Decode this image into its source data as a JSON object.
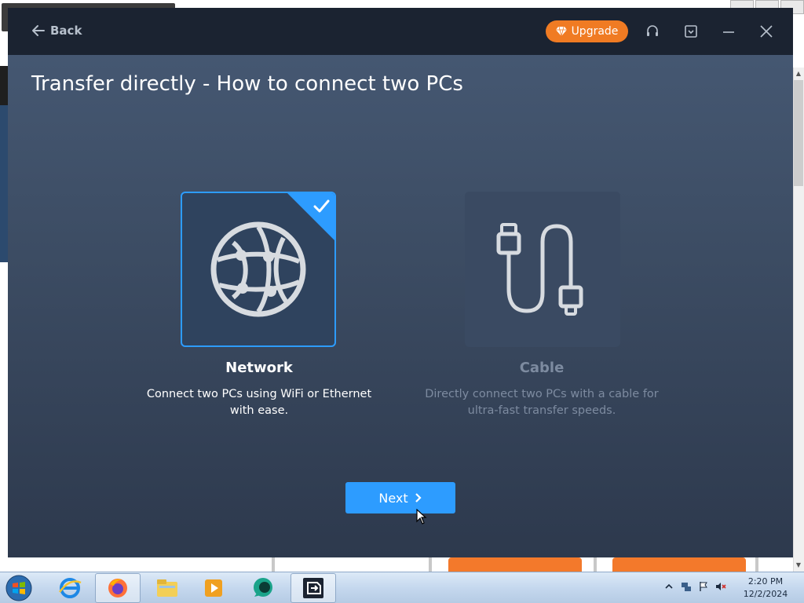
{
  "titlebar": {
    "back_label": "Back",
    "upgrade_label": "Upgrade"
  },
  "main": {
    "title": "Transfer directly - How to connect two PCs",
    "options": [
      {
        "title": "Network",
        "description": "Connect two PCs using WiFi or Ethernet with ease.",
        "selected": true,
        "icon": "globe-icon"
      },
      {
        "title": "Cable",
        "description": "Directly connect two PCs with a cable for ultra-fast transfer speeds.",
        "selected": false,
        "icon": "usb-cable-icon"
      }
    ],
    "next_label": "Next"
  },
  "taskbar": {
    "time": "2:20 PM",
    "date": "12/2/2024",
    "apps": [
      "internet-explorer-icon",
      "firefox-icon",
      "file-explorer-icon",
      "media-player-icon",
      "chat-app-icon",
      "transfer-app-icon"
    ]
  },
  "colors": {
    "accent": "#2d9cff",
    "upgrade": "#f07b23",
    "titlebar": "#1b2331"
  }
}
